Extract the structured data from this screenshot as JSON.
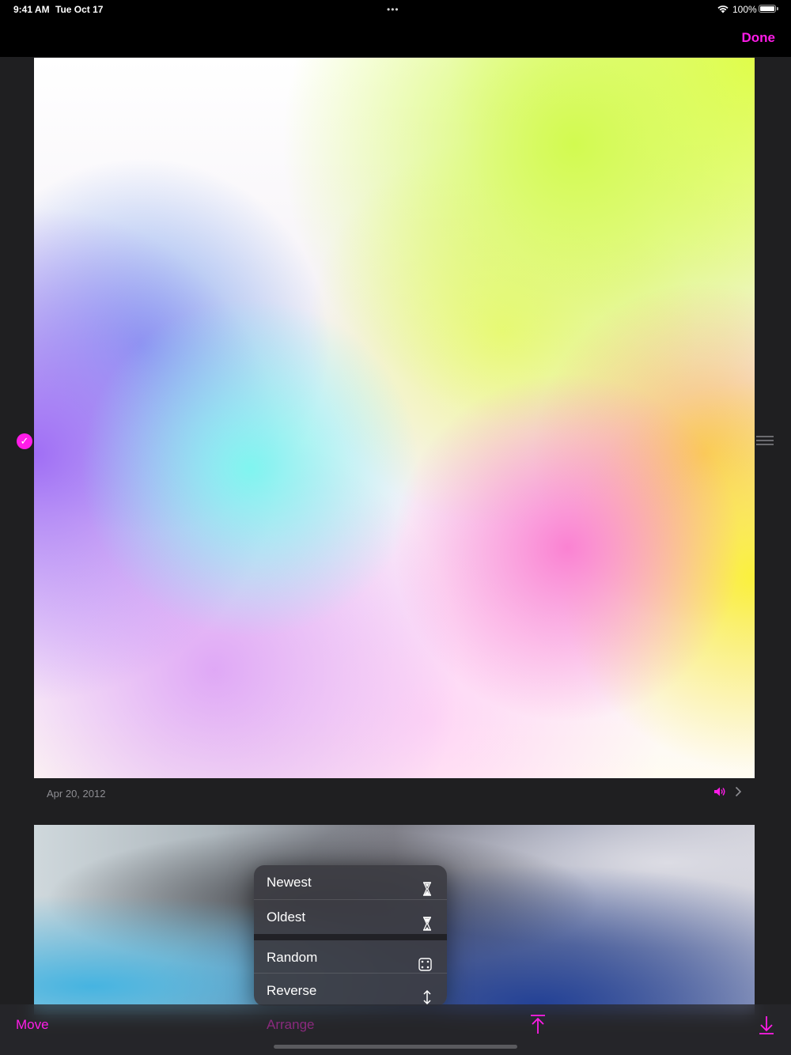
{
  "status_bar": {
    "time": "9:41 AM",
    "date": "Tue Oct 17",
    "battery": "100%",
    "multitask_dots": "•••"
  },
  "nav": {
    "done_label": "Done"
  },
  "photos": [
    {
      "date": "Apr 20, 2012",
      "selected": true,
      "has_audio": true
    },
    {
      "date": "",
      "selected": false
    }
  ],
  "menu": {
    "items": [
      {
        "label": "Newest",
        "icon": "hourglass-icon"
      },
      {
        "label": "Oldest",
        "icon": "hourglass-icon"
      },
      {
        "label": "Random",
        "icon": "dice-icon"
      },
      {
        "label": "Reverse",
        "icon": "up-down-arrow-icon"
      }
    ]
  },
  "toolbar": {
    "move_label": "Move",
    "arrange_label": "Arrange",
    "top_icon": "arrow-to-top-icon",
    "bottom_icon": "arrow-to-bottom-icon"
  },
  "colors": {
    "accent": "#ff1ce8",
    "background": "#1f1f21"
  }
}
